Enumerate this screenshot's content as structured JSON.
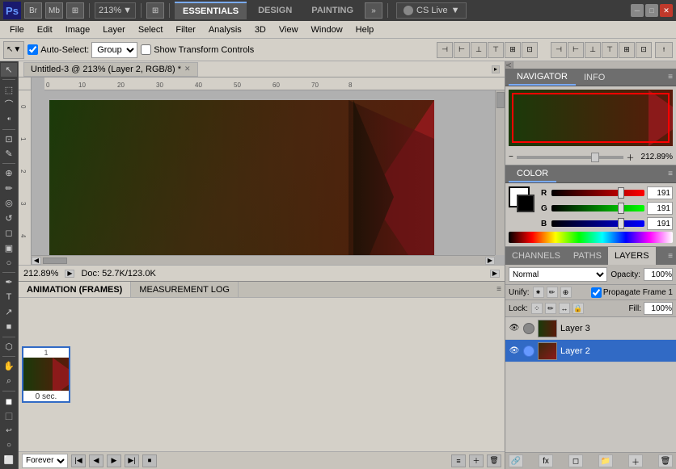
{
  "app": {
    "logo": "Ps",
    "title": "Untitled-3 @ 213% (Layer 2, RGB/8) *"
  },
  "topbar": {
    "bridge_icon": "Br",
    "mini_bridge_icon": "Mb",
    "arrange_icon": "⊞",
    "zoom_value": "213%",
    "workspaces": [
      {
        "label": "ESSENTIALS",
        "active": true
      },
      {
        "label": "DESIGN",
        "active": false
      },
      {
        "label": "PAINTING",
        "active": false
      }
    ],
    "more_btn": "»",
    "cs_live_label": "CS Live",
    "min_btn": "─",
    "max_btn": "□",
    "close_btn": "✕"
  },
  "menubar": {
    "items": [
      "File",
      "Edit",
      "Image",
      "Layer",
      "Select",
      "Filter",
      "Analysis",
      "3D",
      "View",
      "Window",
      "Help"
    ]
  },
  "optionsbar": {
    "tool_icon": "↖",
    "auto_select_label": "Auto-Select:",
    "auto_select_value": "Group",
    "show_transform": "Show Transform Controls",
    "align_btns": [
      "⊣",
      "⊢",
      "⊥",
      "⊤",
      "⊞",
      "⊡"
    ],
    "distribute_btns": [
      "⊣",
      "⊢",
      "⊥",
      "⊤",
      "⊞",
      "⊡"
    ]
  },
  "tools": [
    {
      "name": "move",
      "icon": "↖"
    },
    {
      "name": "select-rect",
      "icon": "⬚"
    },
    {
      "name": "lasso",
      "icon": "⌒"
    },
    {
      "name": "quick-select",
      "icon": "⁌"
    },
    {
      "name": "crop",
      "icon": "⊡"
    },
    {
      "name": "eyedropper",
      "icon": "✎"
    },
    {
      "name": "healing",
      "icon": "⊕"
    },
    {
      "name": "brush",
      "icon": "✏"
    },
    {
      "name": "clone",
      "icon": "◎"
    },
    {
      "name": "history-brush",
      "icon": "↺"
    },
    {
      "name": "eraser",
      "icon": "◻"
    },
    {
      "name": "gradient",
      "icon": "▣"
    },
    {
      "name": "dodge",
      "icon": "○"
    },
    {
      "name": "pen",
      "icon": "✒"
    },
    {
      "name": "type",
      "icon": "T"
    },
    {
      "name": "path-select",
      "icon": "↗"
    },
    {
      "name": "shape",
      "icon": "■"
    },
    {
      "name": "3d",
      "icon": "⬡"
    },
    {
      "name": "hand",
      "icon": "✋"
    },
    {
      "name": "zoom-tool",
      "icon": "🔍"
    },
    {
      "name": "fg-color",
      "icon": "■"
    },
    {
      "name": "bg-color",
      "icon": "□"
    },
    {
      "name": "mode",
      "icon": "○"
    },
    {
      "name": "screen",
      "icon": "⬜"
    }
  ],
  "document": {
    "tab_title": "Untitled-3 @ 213% (Layer 2, RGB/8) *",
    "zoom": "212.89%",
    "doc_size": "Doc: 52.7K/123.0K",
    "ruler_start": 0,
    "ruler_marks": [
      0,
      10,
      20,
      30,
      40,
      50,
      60,
      70
    ]
  },
  "navigator": {
    "tab_label": "NAVIGATOR",
    "info_tab": "INFO",
    "zoom_value": "212.89%",
    "zoom_pct": 71
  },
  "color": {
    "panel_label": "COLOR",
    "r_label": "R",
    "g_label": "G",
    "b_label": "B",
    "r_value": "191",
    "g_value": "191",
    "b_value": "191",
    "r_pct": 75,
    "g_pct": 75,
    "b_pct": 75
  },
  "layers": {
    "channels_tab": "CHANNELS",
    "paths_tab": "PATHS",
    "layers_tab": "LAYERS",
    "blend_mode": "Normal",
    "opacity_label": "Opacity:",
    "opacity_value": "100%",
    "unify_label": "Unify:",
    "lock_label": "Lock:",
    "fill_label": "Fill:",
    "fill_value": "100%",
    "propagate_label": "Propagate Frame 1",
    "items": [
      {
        "name": "Layer 3",
        "visible": true,
        "selected": false,
        "has_badge": false
      },
      {
        "name": "Layer 2",
        "visible": true,
        "selected": true,
        "has_badge": false
      }
    ],
    "footer_btns": [
      "🔗",
      "fx",
      "◻",
      "📁",
      "＋",
      "🗑"
    ]
  },
  "animation": {
    "tab1": "ANIMATION (FRAMES)",
    "tab2": "MEASUREMENT LOG",
    "frame_time": "0 sec.",
    "forever_label": "Forever",
    "ctrl_btns": [
      "|◀",
      "◀",
      "▶",
      "▶|",
      "⏹"
    ]
  }
}
